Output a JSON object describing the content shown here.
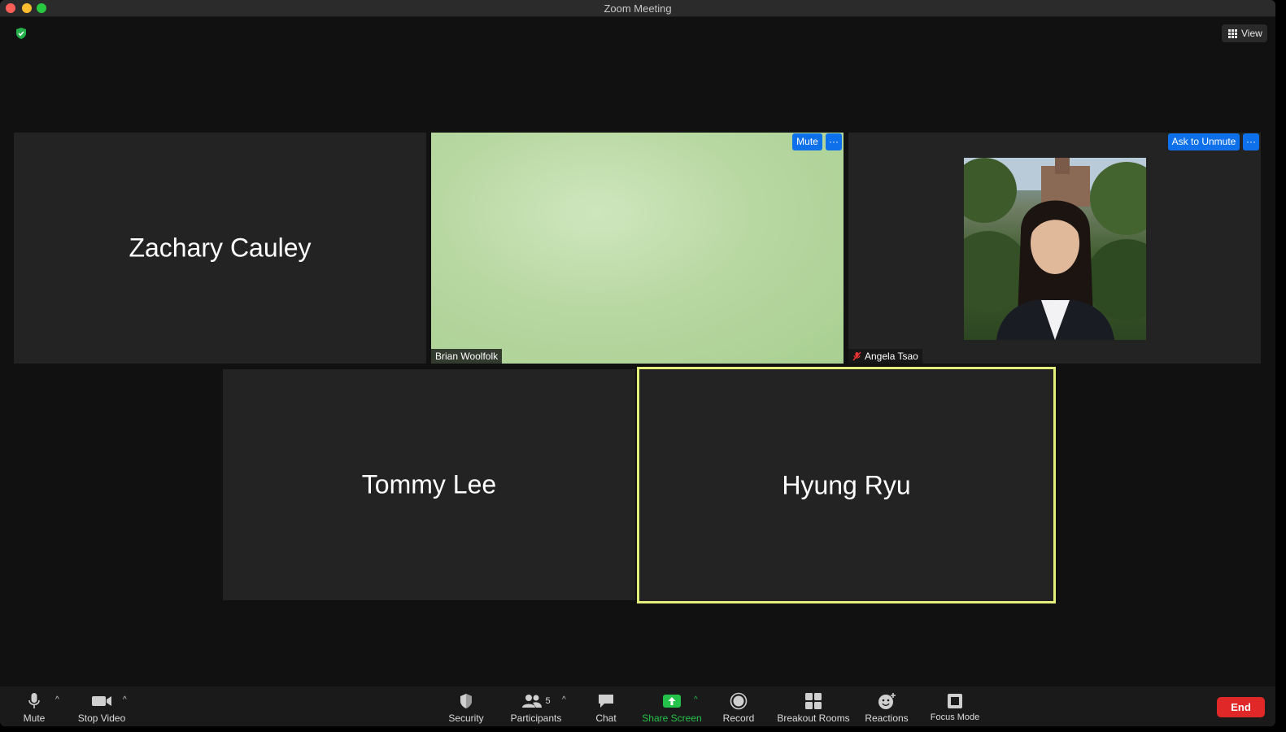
{
  "window": {
    "title": "Zoom Meeting"
  },
  "top": {
    "view_label": "View"
  },
  "tiles": {
    "zachary": {
      "name": "Zachary Cauley"
    },
    "brian": {
      "name": "Brian Woolfolk",
      "mute_label": "Mute",
      "more_label": "···"
    },
    "angela": {
      "name": "Angela Tsao",
      "unmute_label": "Ask to Unmute",
      "more_label": "···"
    },
    "tommy": {
      "name": "Tommy Lee"
    },
    "hyung": {
      "name": "Hyung Ryu"
    }
  },
  "toolbar": {
    "mute": "Mute",
    "stop_video": "Stop Video",
    "security": "Security",
    "participants": "Participants",
    "participants_count": "5",
    "chat": "Chat",
    "share_screen": "Share Screen",
    "record": "Record",
    "breakout_rooms": "Breakout Rooms",
    "reactions": "Reactions",
    "focus_mode": "Focus Mode",
    "end": "End"
  },
  "colors": {
    "accent_blue": "#0e71eb",
    "active_speaker": "#e3ee7d",
    "share_green": "#24c24a",
    "end_red": "#e02828"
  }
}
